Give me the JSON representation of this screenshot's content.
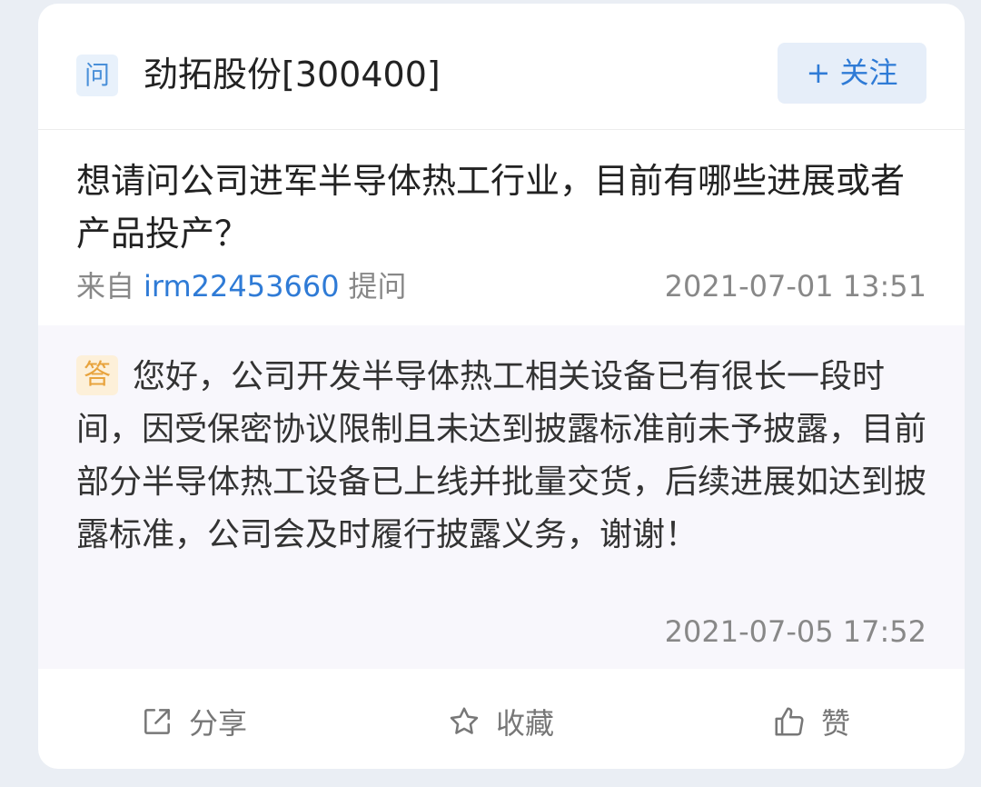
{
  "header": {
    "question_badge": "问",
    "company": "劲拓股份[300400]",
    "follow_label": "+ 关注"
  },
  "question": {
    "text": "想请问公司进军半导体热工行业，目前有哪些进展或者产品投产？",
    "from_label": "来自",
    "user": "irm22453660",
    "ask_label": "提问",
    "time": "2021-07-01 13:51"
  },
  "answer": {
    "badge": "答",
    "text": "您好，公司开发半导体热工相关设备已有很长一段时间，因受保密协议限制且未达到披露标准前未予披露，目前部分半导体热工设备已上线并批量交货，后续进展如达到披露标准，公司会及时履行披露义务，谢谢！",
    "time": "2021-07-05 17:52"
  },
  "actions": {
    "share": {
      "label": "分享",
      "icon": "share-icon"
    },
    "favorite": {
      "label": "收藏",
      "icon": "star-icon"
    },
    "like": {
      "label": "赞",
      "icon": "thumbs-up-icon"
    }
  },
  "colors": {
    "accent": "#2f7bd6",
    "answer_badge": "#e8a33d",
    "answer_bg": "#f8f7fc",
    "page_bg": "#eaeef4"
  }
}
